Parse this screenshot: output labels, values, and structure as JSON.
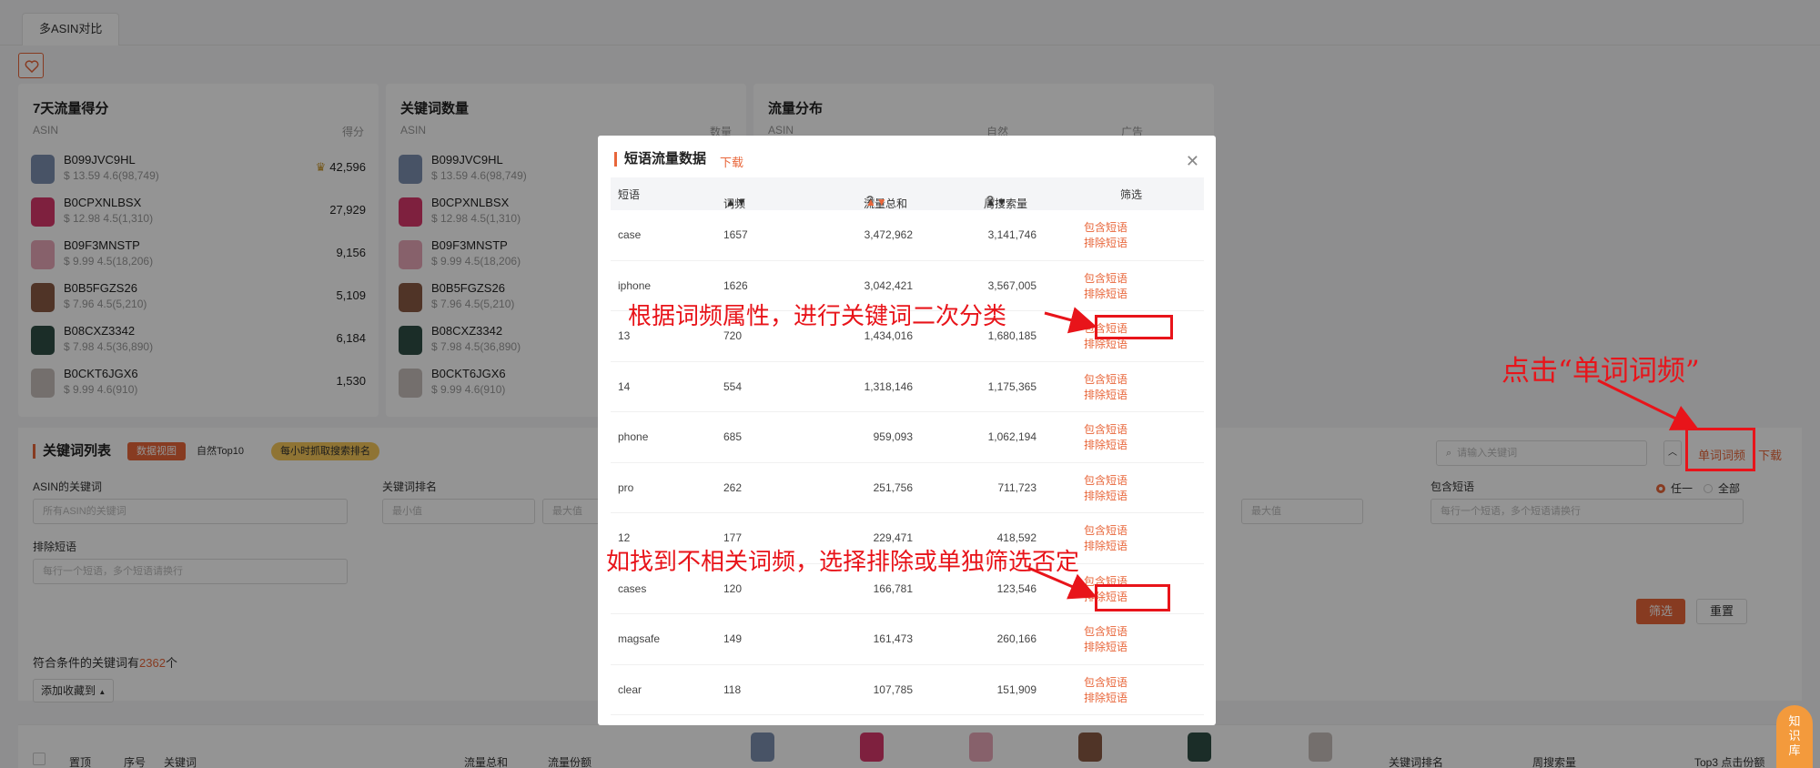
{
  "tab": "多ASIN对比",
  "cards": [
    {
      "title": "7天流量得分",
      "col_left": "ASIN",
      "col_right": "得分",
      "rows": [
        {
          "asin": "B099JVC9HL",
          "price": "$ 13.59  4.6(98,749)",
          "value": "42,596"
        },
        {
          "asin": "B0CPXNLBSX",
          "price": "$ 12.98  4.5(1,310)",
          "value": "27,929"
        },
        {
          "asin": "B09F3MNSTP",
          "price": "$ 9.99  4.5(18,206)",
          "value": "9,156"
        },
        {
          "asin": "B0B5FGZS26",
          "price": "$ 7.96  4.5(5,210)",
          "value": "5,109"
        },
        {
          "asin": "B08CXZ3342",
          "price": "$ 7.98  4.5(36,890)",
          "value": "6,184"
        },
        {
          "asin": "B0CKT6JGX6",
          "price": "$ 9.99  4.6(910)",
          "value": "1,530"
        }
      ]
    },
    {
      "title": "关键词数量",
      "col_left": "ASIN",
      "col_right": "数量",
      "rows": [
        {
          "asin": "B099JVC9HL",
          "price": "$ 13.59  4.6(98,749)"
        },
        {
          "asin": "B0CPXNLBSX",
          "price": "$ 12.98  4.5(1,310)"
        },
        {
          "asin": "B09F3MNSTP",
          "price": "$ 9.99  4.5(18,206)"
        },
        {
          "asin": "B0B5FGZS26",
          "price": "$ 7.96  4.5(5,210)"
        },
        {
          "asin": "B08CXZ3342",
          "price": "$ 7.98  4.5(36,890)"
        },
        {
          "asin": "B0CKT6JGX6",
          "price": "$ 9.99  4.6(910)"
        }
      ]
    },
    {
      "title": "流量分布",
      "col_left": "ASIN",
      "col_mid": "自然",
      "col_right": "广告"
    }
  ],
  "thumb_colors": [
    "#7c8fb0",
    "#d9386c",
    "#e9a7b9",
    "#8a5a44",
    "#2f4f46",
    "#c9c0bc"
  ],
  "keyword": {
    "title": "关键词列表",
    "tab_data": "数据视图",
    "tab_top": "自然Top10",
    "hourly": "每小时抓取搜索排名",
    "asin_kw_label": "ASIN的关键词",
    "asin_kw_value": "所有ASIN的关键词",
    "rank_label": "关键词排名",
    "min": "最小值",
    "max": "最大值",
    "max2": "最大值",
    "exclude_label": "排除短语",
    "exclude_ph": "每行一个短语，多个短语请换行",
    "include_label": "包含短语",
    "include_ph": "每行一个短语，多个短语请换行",
    "any": "任一",
    "all": "全部",
    "search_ph": "请输入关键词",
    "word_freq": "单词词频",
    "download": "下载",
    "filter": "筛选",
    "reset": "重置",
    "count_prefix": "符合条件的关键词有",
    "count": "2362",
    "count_suffix": "个",
    "add_fav": "添加收藏到"
  },
  "bottom_headers": [
    "置顶",
    "序号",
    "关键词",
    "流量总和",
    "流量份额",
    "关键词排名",
    "周搜索量",
    "Top3 点击份额"
  ],
  "modal": {
    "title": "短语流量数据",
    "download": "下载",
    "headers": [
      "短语",
      "词频",
      "流量总和",
      "周搜索量",
      "筛选"
    ],
    "include": "包含短语",
    "exclude": "排除短语",
    "rows": [
      {
        "phrase": "case",
        "freq": "1657",
        "traffic": "3,472,962",
        "search": "3,141,746"
      },
      {
        "phrase": "iphone",
        "freq": "1626",
        "traffic": "3,042,421",
        "search": "3,567,005"
      },
      {
        "phrase": "13",
        "freq": "720",
        "traffic": "1,434,016",
        "search": "1,680,185"
      },
      {
        "phrase": "14",
        "freq": "554",
        "traffic": "1,318,146",
        "search": "1,175,365"
      },
      {
        "phrase": "phone",
        "freq": "685",
        "traffic": "959,093",
        "search": "1,062,194"
      },
      {
        "phrase": "pro",
        "freq": "262",
        "traffic": "251,756",
        "search": "711,723"
      },
      {
        "phrase": "12",
        "freq": "177",
        "traffic": "229,471",
        "search": "418,592"
      },
      {
        "phrase": "cases",
        "freq": "120",
        "traffic": "166,781",
        "search": "123,546"
      },
      {
        "phrase": "magsafe",
        "freq": "149",
        "traffic": "161,473",
        "search": "260,166"
      },
      {
        "phrase": "clear",
        "freq": "118",
        "traffic": "107,785",
        "search": "151,909"
      }
    ]
  },
  "annotations": {
    "a1": "根据词频属性，进行关键词二次分类",
    "a2": "点击“单词词频”",
    "a3": "如找到不相关词频，选择排除或单独筛选否定"
  },
  "badge": "知识库",
  "colors": {
    "accent": "#e8663a",
    "annotation": "#e8141a"
  }
}
